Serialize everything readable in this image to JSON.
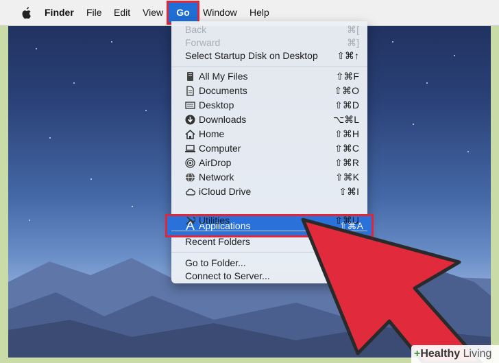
{
  "menubar": {
    "app_name": "Finder",
    "items": [
      "File",
      "Edit",
      "View",
      "Go",
      "Window",
      "Help"
    ]
  },
  "go_menu": {
    "nav": [
      {
        "label": "Back",
        "shortcut": "⌘[",
        "disabled": true
      },
      {
        "label": "Forward",
        "shortcut": "⌘]",
        "disabled": true
      },
      {
        "label": "Select Startup Disk on Desktop",
        "shortcut": "⇧⌘↑",
        "disabled": false
      }
    ],
    "places": [
      {
        "label": "All My Files",
        "shortcut": "⇧⌘F",
        "icon": "all-files-icon"
      },
      {
        "label": "Documents",
        "shortcut": "⇧⌘O",
        "icon": "documents-icon"
      },
      {
        "label": "Desktop",
        "shortcut": "⇧⌘D",
        "icon": "desktop-icon"
      },
      {
        "label": "Downloads",
        "shortcut": "⌥⌘L",
        "icon": "downloads-icon"
      },
      {
        "label": "Home",
        "shortcut": "⇧⌘H",
        "icon": "home-icon"
      },
      {
        "label": "Computer",
        "shortcut": "⇧⌘C",
        "icon": "computer-icon"
      },
      {
        "label": "AirDrop",
        "shortcut": "⇧⌘R",
        "icon": "airdrop-icon"
      },
      {
        "label": "Network",
        "shortcut": "⇧⌘K",
        "icon": "network-icon"
      },
      {
        "label": "iCloud Drive",
        "shortcut": "⇧⌘I",
        "icon": "icloud-icon"
      },
      {
        "label": "Applications",
        "shortcut": "⇧⌘A",
        "icon": "applications-icon"
      },
      {
        "label": "Utilities",
        "shortcut": "⇧⌘U",
        "icon": "utilities-icon"
      }
    ],
    "recent": {
      "label": "Recent Folders"
    },
    "goto": [
      {
        "label": "Go to Folder..."
      },
      {
        "label": "Connect to Server..."
      }
    ]
  },
  "watermark": {
    "plus": "+",
    "word1": "Healthy",
    "word2": "Living"
  },
  "colors": {
    "highlight": "#2a72d9",
    "annotation_red": "#e0273a"
  }
}
